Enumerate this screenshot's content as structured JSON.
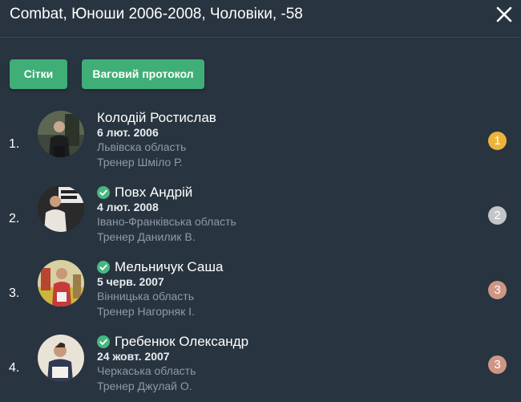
{
  "header": {
    "title": "Combat, Юноши 2006-2008, Чоловіки, -58",
    "close_icon": "close-icon"
  },
  "toolbar": {
    "grids_label": "Сітки",
    "weigh_in_label": "Ваговий протокол"
  },
  "colors": {
    "background": "#28343f",
    "button": "#3fae77",
    "check": "#47b780",
    "gold": "#eeb33a",
    "silver": "#c3c6c8",
    "bronze": "#cf9684"
  },
  "athletes": [
    {
      "rank": "1.",
      "name": "Колодій Ростислав",
      "verified": false,
      "dob": "6 лют. 2006",
      "region": "Львівска область",
      "coach": "Тренер Шміло Р.",
      "place": "1",
      "medal": "gold"
    },
    {
      "rank": "2.",
      "name": "Повх Андрій",
      "verified": true,
      "dob": "4 лют. 2008",
      "region": "Івано-Франківська область",
      "coach": "Тренер Данилик В.",
      "place": "2",
      "medal": "silver"
    },
    {
      "rank": "3.",
      "name": "Мельничук Саша",
      "verified": true,
      "dob": "5 черв. 2007",
      "region": "Вінницька область",
      "coach": "Тренер Нагорняк І.",
      "place": "3",
      "medal": "bronze"
    },
    {
      "rank": "4.",
      "name": "Гребенюк Олександр",
      "verified": true,
      "dob": "24 жовт. 2007",
      "region": "Черкаська область",
      "coach": "Тренер Джулай О.",
      "place": "3",
      "medal": "bronze"
    }
  ]
}
